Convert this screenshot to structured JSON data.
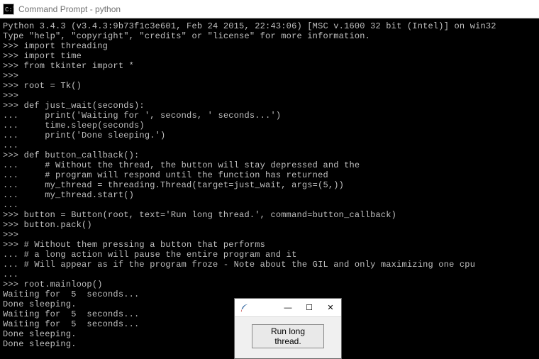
{
  "window": {
    "title": "Command Prompt - python"
  },
  "console": {
    "lines": [
      "Python 3.4.3 (v3.4.3:9b73f1c3e601, Feb 24 2015, 22:43:06) [MSC v.1600 32 bit (Intel)] on win32",
      "Type \"help\", \"copyright\", \"credits\" or \"license\" for more information.",
      ">>> import threading",
      ">>> import time",
      ">>> from tkinter import *",
      ">>>",
      ">>> root = Tk()",
      ">>>",
      ">>> def just_wait(seconds):",
      "...     print('Waiting for ', seconds, ' seconds...')",
      "...     time.sleep(seconds)",
      "...     print('Done sleeping.')",
      "...",
      ">>> def button_callback():",
      "...     # Without the thread, the button will stay depressed and the",
      "...     # program will respond until the function has returned",
      "...     my_thread = threading.Thread(target=just_wait, args=(5,))",
      "...     my_thread.start()",
      "...",
      ">>> button = Button(root, text='Run long thread.', command=button_callback)",
      ">>> button.pack()",
      ">>>",
      ">>> # Without them pressing a button that performs",
      "... # a long action will pause the entire program and it",
      "... # Will appear as if the program froze - Note about the GIL and only maximizing one cpu",
      "...",
      ">>> root.mainloop()",
      "Waiting for  5  seconds...",
      "Done sleeping.",
      "Waiting for  5  seconds...",
      "Waiting for  5  seconds...",
      "Done sleeping.",
      "Done sleeping."
    ]
  },
  "tk_window": {
    "button_label": "Run long thread.",
    "controls": {
      "minimize": "—",
      "maximize": "☐",
      "close": "✕"
    }
  }
}
